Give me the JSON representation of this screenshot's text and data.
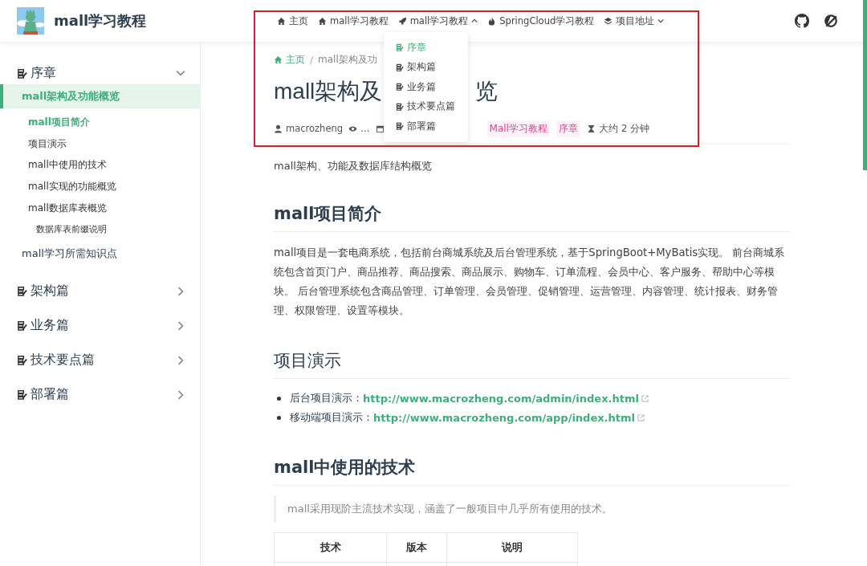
{
  "header": {
    "site_title": "mall学习教程",
    "nav": [
      {
        "kind": "link",
        "label": "主页"
      },
      {
        "kind": "link",
        "label": "mall学习教程"
      },
      {
        "kind": "dropdown",
        "label": "mall学习教程",
        "expanded": true
      },
      {
        "kind": "link",
        "label": "SpringCloud学习教程"
      },
      {
        "kind": "dropdown",
        "label": "项目地址",
        "expanded": false
      }
    ],
    "dropdown_items": [
      {
        "label": "序章",
        "selected": true
      },
      {
        "label": "架构篇",
        "selected": false
      },
      {
        "label": "业务篇",
        "selected": false
      },
      {
        "label": "技术要点篇",
        "selected": false
      },
      {
        "label": "部署篇",
        "selected": false
      }
    ]
  },
  "sidebar": [
    {
      "label": "序章",
      "expanded": true,
      "children": [
        {
          "label": "mall架构及功能概览",
          "selected": true,
          "children": [
            {
              "label": "mall项目简介",
              "current": true
            },
            {
              "label": "项目演示",
              "current": false
            },
            {
              "label": "mall中使用的技术",
              "current": false
            },
            {
              "label": "mall实现的功能概览",
              "current": false
            },
            {
              "label": "mall数据库表概览",
              "current": false,
              "children": [
                {
                  "label": "数据库表前缀说明"
                }
              ]
            }
          ]
        },
        {
          "label": "mall学习所需知识点",
          "selected": false
        }
      ]
    },
    {
      "label": "架构篇",
      "expanded": false
    },
    {
      "label": "业务篇",
      "expanded": false
    },
    {
      "label": "技术要点篇",
      "expanded": false
    },
    {
      "label": "部署篇",
      "expanded": false
    }
  ],
  "page": {
    "breadcrumb": [
      {
        "label": "主页",
        "kind": "home"
      },
      {
        "label": "mall架构及功",
        "kind": "current"
      }
    ],
    "breadcrumb_separator": "/",
    "title_visible_parts": [
      "mall架构及",
      "览"
    ],
    "meta": {
      "author": "macrozheng",
      "views": "...",
      "tags": [
        "Mall学习教程",
        "序章"
      ],
      "reading_time": "大约 2 分钟"
    },
    "description": "mall架构、功能及数据库结构概览",
    "sections": [
      {
        "kind": "paragraph",
        "heading": "mall项目简介",
        "text": "mall项目是一套电商系统，包括前台商城系统及后台管理系统，基于SpringBoot+MyBatis实现。 前台商城系统包含首页门户、商品推荐、商品搜索、商品展示、购物车、订单流程、会员中心、客户服务、帮助中心等模块。 后台管理系统包含商品管理、订单管理、会员管理、促销管理、运营管理、内容管理、统计报表、财务管理、权限管理、设置等模块。"
      },
      {
        "kind": "links",
        "heading": "项目演示",
        "items": [
          {
            "label": "后台项目演示：",
            "url": "http://www.macrozheng.com/admin/index.html"
          },
          {
            "label": "移动端项目演示：",
            "url": "http://www.macrozheng.com/app/index.html"
          }
        ]
      },
      {
        "kind": "table",
        "heading": "mall中使用的技术",
        "quote": "mall采用现阶主流技术实现，涵盖了一般项目中几乎所有使用的技术。",
        "columns": [
          "技术",
          "版本",
          "说明"
        ]
      }
    ]
  }
}
